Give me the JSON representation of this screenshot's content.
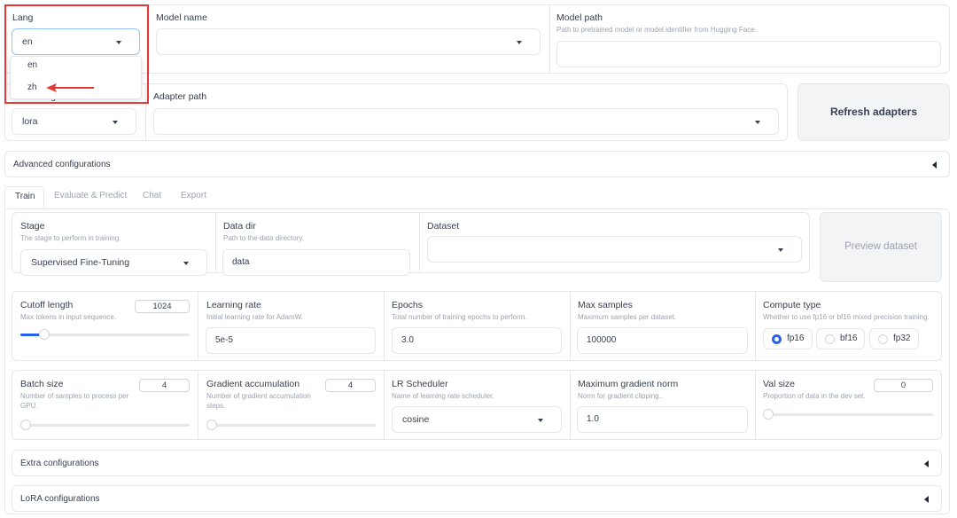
{
  "top": {
    "lang": {
      "label": "Lang",
      "value": "en",
      "options": [
        "en",
        "zh"
      ]
    },
    "model_name": {
      "label": "Model name",
      "value": ""
    },
    "model_path": {
      "label": "Model path",
      "info": "Path to pretrained model or model identifier from Hugging Face.",
      "value": ""
    }
  },
  "second": {
    "finetuning_method": {
      "label": "Finetuning method",
      "value": "lora"
    },
    "adapter_path": {
      "label": "Adapter path",
      "value": ""
    },
    "refresh_label": "Refresh adapters"
  },
  "advanced": {
    "label": "Advanced configurations"
  },
  "tabs": [
    {
      "label": "Train",
      "active": true
    },
    {
      "label": "Evaluate & Predict",
      "active": false
    },
    {
      "label": "Chat",
      "active": false
    },
    {
      "label": "Export",
      "active": false
    }
  ],
  "train": {
    "stage": {
      "label": "Stage",
      "info": "The stage to perform in training.",
      "value": "Supervised Fine-Tuning"
    },
    "data_dir": {
      "label": "Data dir",
      "info": "Path to the data directory.",
      "value": "data"
    },
    "dataset": {
      "label": "Dataset",
      "value": ""
    },
    "preview_label": "Preview dataset",
    "cutoff": {
      "label": "Cutoff length",
      "info": "Max tokens in input sequence.",
      "value": "1024",
      "min": 4,
      "max": 8192,
      "fraction": 0.12
    },
    "lr": {
      "label": "Learning rate",
      "info": "Initial learning rate for AdamW.",
      "value": "5e-5"
    },
    "epochs": {
      "label": "Epochs",
      "info": "Total number of training epochs to perform.",
      "value": "3.0"
    },
    "max_samples": {
      "label": "Max samples",
      "info": "Maximum samples per dataset.",
      "value": "100000"
    },
    "compute": {
      "label": "Compute type",
      "info": "Whether to use fp16 or bf16 mixed precision training.",
      "options": [
        "fp16",
        "bf16",
        "fp32"
      ],
      "selected": "fp16"
    },
    "batch": {
      "label": "Batch size",
      "info": "Number of samples to process per GPU.",
      "value": "4",
      "fraction": 0.0
    },
    "grad_acc": {
      "label": "Gradient accumulation",
      "info": "Number of gradient accumulation steps.",
      "value": "4",
      "fraction": 0.0
    },
    "lr_sched": {
      "label": "LR Scheduler",
      "info": "Name of learning rate scheduler.",
      "value": "cosine"
    },
    "max_grad": {
      "label": "Maximum gradient norm",
      "info": "Norm for gradient clipping..",
      "value": "1.0"
    },
    "val_size": {
      "label": "Val size",
      "info": "Proportion of data in the dev set.",
      "value": "0",
      "fraction": 0.0
    }
  },
  "extra": {
    "label": "Extra configurations"
  },
  "lora_cfg": {
    "label": "LoRA configurations"
  },
  "colors": {
    "accent": "#2563eb",
    "highlight": "#e53935",
    "border": "#e5e7eb"
  }
}
